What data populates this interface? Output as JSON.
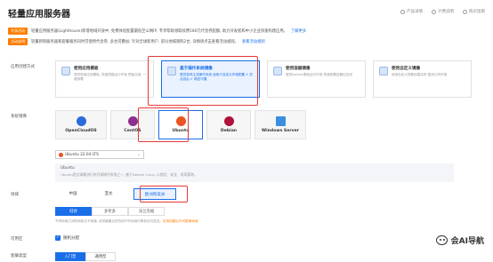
{
  "page": {
    "title": "轻量应用服务器"
  },
  "top_links": [
    "产品详情",
    "计费说明",
    "购买指南"
  ],
  "notices": [
    {
      "tag": "专享活动",
      "text": "轻量应用服务器(Lighthouse)新增地域开放中, 免费体验配置最低至公网IP, 专享帮助领取续费180元代金券配额, 助力开发者和中小企业快速构建应用。",
      "link": "了解更多"
    },
    {
      "tag": "活动说明",
      "text": "轻量新购服务器和套餐服务同时可使用代金券, 多台可叠加; 针对全球新用户, 部分地域限购2台, 详情请点击查看活动规则。",
      "link": "查看活动规则"
    }
  ],
  "labels": {
    "create_way": "应用创建方式",
    "os": "系统镜像",
    "region": "地域",
    "zone": "可用区",
    "package": "套餐类型"
  },
  "create_ways": [
    {
      "title": "使用应用模板",
      "desc": "提供常用应用模板, 快速搭建运行环境 预装应用, 一键部署",
      "active": false
    },
    {
      "title": "基于操作系统镜像",
      "desc": "提供多种主流操作系统 适用于自定义环境配置 ✔ 灵活自由 ✔ 稳定可靠",
      "active": true
    },
    {
      "title": "使用容器镜像",
      "desc": "提供Docker基础运行环境 快速部署容器化应用",
      "active": false
    },
    {
      "title": "使用自定义镜像",
      "desc": "使用自定义镜像创建实例 复用已有环境",
      "active": false
    }
  ],
  "os_options": [
    {
      "name": "OpenCloudOS",
      "color": "#2b6cd9",
      "active": false
    },
    {
      "name": "CentOS",
      "color": "#8b2f8f",
      "active": false
    },
    {
      "name": "Ubuntu",
      "color": "#e95420",
      "active": true
    },
    {
      "name": "Debian",
      "color": "#b0123c",
      "active": false
    },
    {
      "name": "Windows Server",
      "color": "#3c8fe0",
      "active": false
    }
  ],
  "os_version": "Ubuntu 22.04 LTS",
  "os_info": {
    "head": "Ubuntu",
    "body": "Ubuntu是全球最流行的开源操作系统之一, 基于Debian Linux, 以稳定、安全、易用著称。"
  },
  "regions": [
    "中国",
    "亚太",
    "欧洲和美洲"
  ],
  "zones": [
    "硅谷",
    "多伦多",
    "法兰克福"
  ],
  "region_note_prefix": "不同地域之间的网络互不相通, 选择最靠近您的用户的地域可降低访问延迟。",
  "region_note_highlight": "实例创建后不可更换地域",
  "zone_random_label": "随机分配",
  "packages": [
    "入门型",
    "通用型"
  ],
  "watermark": "会AI导航"
}
